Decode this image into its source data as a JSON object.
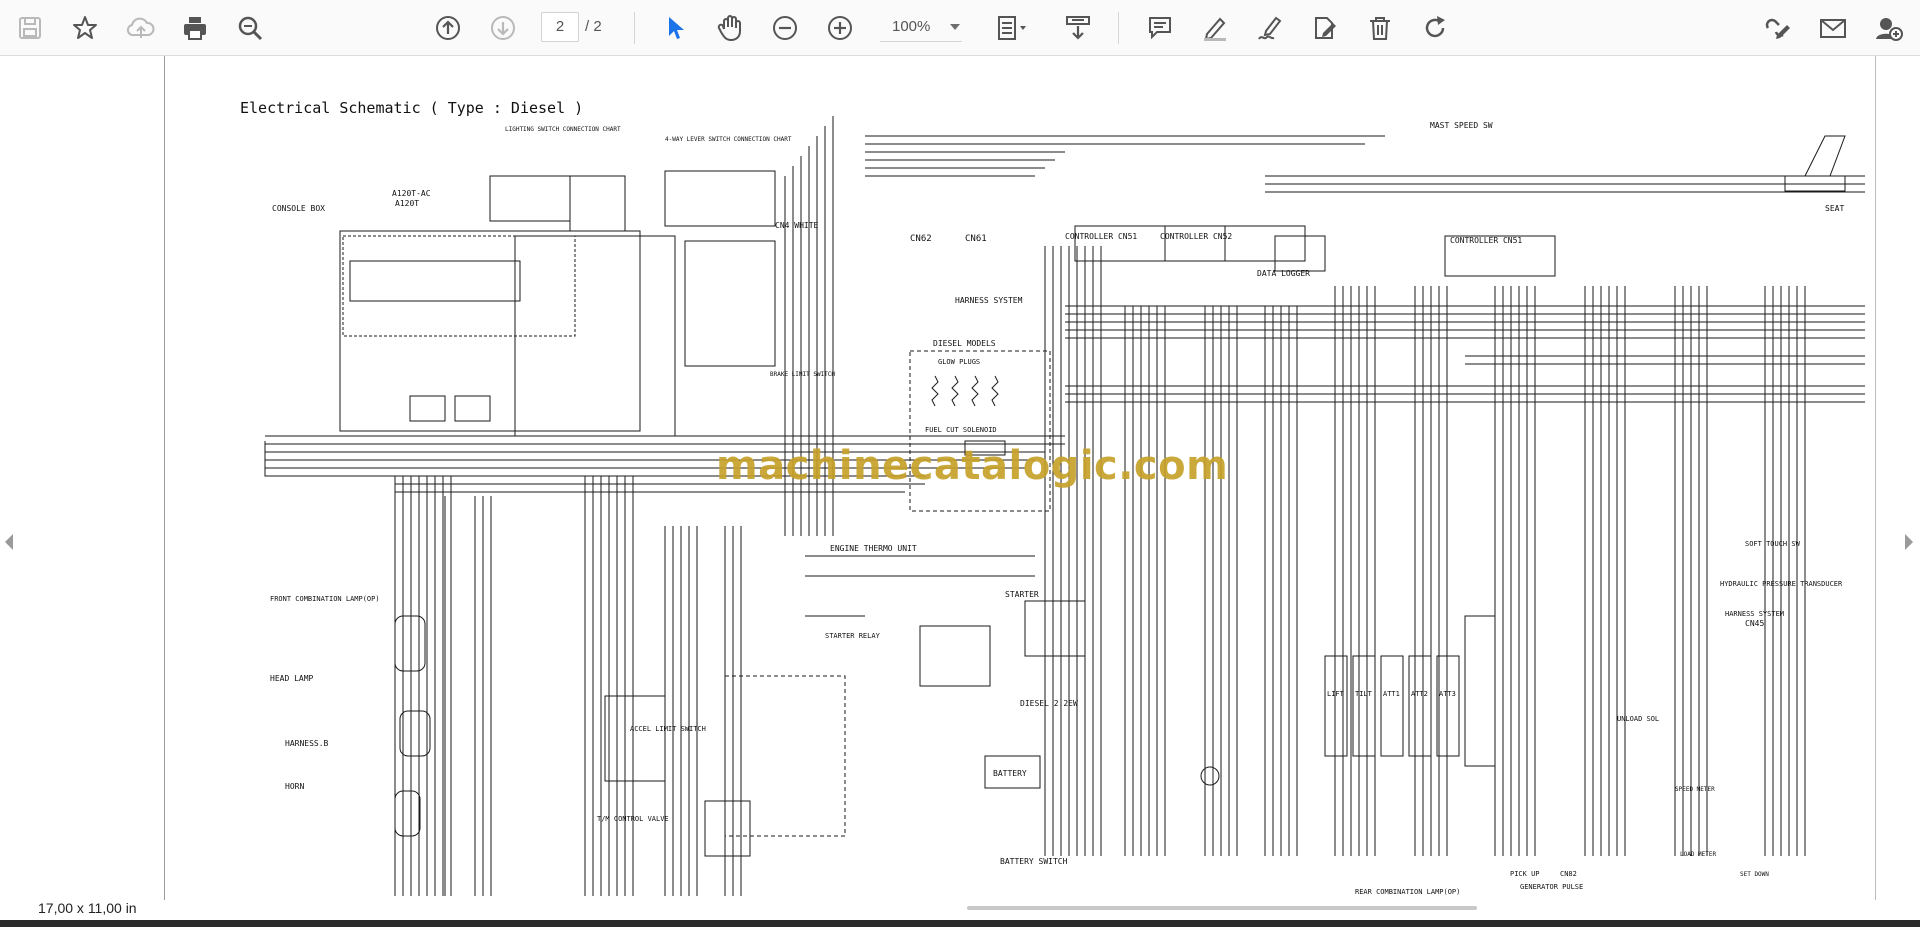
{
  "toolbar": {
    "page_current": "2",
    "page_total": "/ 2",
    "zoom": "100%",
    "icons": [
      "save-icon",
      "bookmark-star-icon",
      "cloud-upload-icon",
      "print-icon",
      "zoom-search-icon",
      "page-up-icon",
      "page-down-icon",
      "select-pointer-icon",
      "hand-pan-icon",
      "zoom-out-icon",
      "zoom-in-icon",
      "fit-page-icon",
      "scroll-mode-icon",
      "comment-icon",
      "highlight-pen-icon",
      "draw-sign-icon",
      "edit-text-icon",
      "delete-icon",
      "rotate-icon",
      "link-edit-icon",
      "email-icon",
      "account-add-icon"
    ],
    "accent_color": "#1a73e8"
  },
  "document": {
    "watermark": "machinecatalogic.com",
    "page_size": "17,00 x 11,00 in",
    "labels": {
      "title": "Electrical Schematic ( Type : Diesel )",
      "console_box": "CONSOLE BOX",
      "a120t": "A120T-AC",
      "a120t2": "A120T",
      "cn4_white": "CN4 WHITE",
      "cn62": "CN62",
      "cn61": "CN61",
      "controller_cn51": "CONTROLLER CN51",
      "controller_cn52": "CONTROLLER CN52",
      "data_logger": "DATA LOGGER",
      "controller_cn51b": "CONTROLLER CN51",
      "harness_system": "HARNESS SYSTEM",
      "diesel_models": "DIESEL MODELS",
      "glow_plugs": "GLOW PLUGS",
      "fuel_cut_solenoid": "FUEL CUT SOLENOID",
      "engine_thermo_unit": "ENGINE THERMO UNIT",
      "starter": "STARTER",
      "starter_relay": "STARTER RELAY",
      "diesel_2": "DIESEL 2.2EW",
      "battery": "BATTERY",
      "battery_switch": "BATTERY SWITCH",
      "front_lamp": "FRONT COMBINATION LAMP(OP)",
      "head_lamp": "HEAD LAMP",
      "harness_b": "HARNESS.B",
      "horn": "HORN",
      "accel_limit_switch": "ACCEL LIMIT SWITCH",
      "tm_control_valve": "T/M CONTROL VALVE",
      "brake_limit_switch": "BRAKE LIMIT SWITCH",
      "hydraulic_pressure": "HYDRAULIC PRESSURE TRANSDUCER",
      "harness_system2": "HARNESS SYSTEM",
      "cn45": "CN45",
      "soft_touch_sw": "SOFT TOUCH SW",
      "unload_sol": "UNLOAD SOL",
      "lift": "LIFT",
      "tilt": "TILT",
      "att1": "ATT1",
      "att2": "ATT2",
      "att3": "ATT3",
      "pick_up": "PICK UP",
      "cn82": "CN82",
      "generator_pulse": "GENERATOR PULSE",
      "rear_lamp": "REAR COMBINATION LAMP(OP)",
      "speed_meter": "SPEED METER",
      "load_meter": "LOAD METER",
      "seat": "SEAT",
      "mast_speed_sw": "MAST SPEED SW",
      "lighting_chart": "LIGHTING SWITCH CONNECTION CHART",
      "lever_chart": "4-WAY LEVER SWITCH CONNECTION CHART",
      "engine_speed_sw": "SET DOWN"
    }
  }
}
